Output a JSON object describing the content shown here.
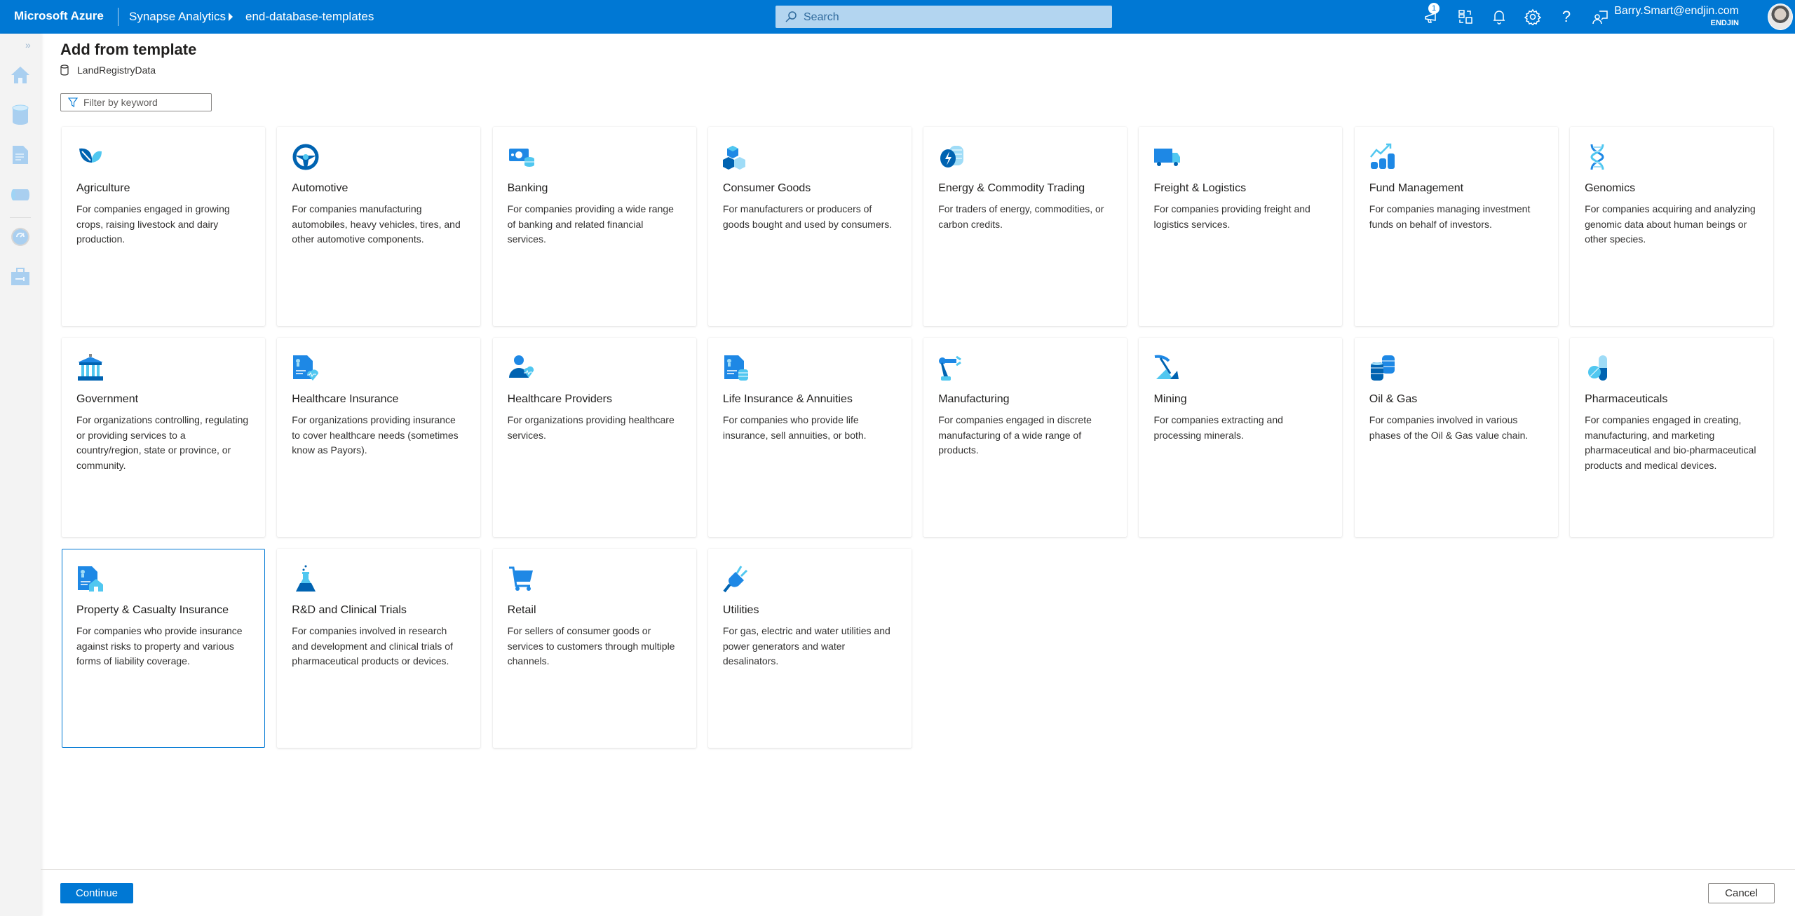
{
  "header": {
    "brand": "Microsoft Azure",
    "breadcrumb": [
      "Synapse Analytics",
      "end-database-templates"
    ],
    "search_placeholder": "Search",
    "notification_count": "1",
    "user_email": "Barry.Smart@endjin.com",
    "user_org": "ENDJIN",
    "icons": [
      "announcement-icon",
      "directory-switch-icon",
      "bell-icon",
      "gear-icon",
      "help-icon",
      "feedback-icon"
    ]
  },
  "sidebar": {
    "expand_label": "»",
    "items": [
      "home-icon",
      "data-icon",
      "develop-icon",
      "integrate-icon",
      "monitor-icon",
      "manage-icon"
    ]
  },
  "page": {
    "title": "Add from template",
    "database_name": "LandRegistryData",
    "filter_placeholder": "Filter by keyword"
  },
  "templates": [
    {
      "title": "Agriculture",
      "desc": "For companies engaged in growing crops, raising livestock and dairy production.",
      "icon": "leaf"
    },
    {
      "title": "Automotive",
      "desc": "For companies manufacturing automobiles, heavy vehicles, tires, and other automotive components.",
      "icon": "steering-wheel"
    },
    {
      "title": "Banking",
      "desc": "For companies providing a wide range of banking and related financial services.",
      "icon": "money"
    },
    {
      "title": "Consumer Goods",
      "desc": "For manufacturers or producers of goods bought and used by consumers.",
      "icon": "cubes"
    },
    {
      "title": "Energy & Commodity Trading",
      "desc": "For traders of energy, commodities, or carbon credits.",
      "icon": "energy"
    },
    {
      "title": "Freight & Logistics",
      "desc": "For companies providing freight and logistics services.",
      "icon": "truck"
    },
    {
      "title": "Fund Management",
      "desc": "For companies managing investment funds on behalf of investors.",
      "icon": "coins-chart"
    },
    {
      "title": "Genomics",
      "desc": "For companies acquiring and analyzing genomic data about human beings or other species.",
      "icon": "dna"
    },
    {
      "title": "Government",
      "desc": "For organizations controlling, regulating or providing services to a country/region, state or province, or community.",
      "icon": "building"
    },
    {
      "title": "Healthcare Insurance",
      "desc": "For organizations providing insurance to cover healthcare needs (sometimes know as Payors).",
      "icon": "doc-heart"
    },
    {
      "title": "Healthcare Providers",
      "desc": "For organizations providing healthcare services.",
      "icon": "person-heart"
    },
    {
      "title": "Life Insurance & Annuities",
      "desc": "For companies who provide life insurance, sell annuities, or both.",
      "icon": "doc-coins"
    },
    {
      "title": "Manufacturing",
      "desc": "For companies engaged in discrete manufacturing of a wide range of products.",
      "icon": "robot-arm"
    },
    {
      "title": "Mining",
      "desc": "For companies extracting and processing minerals.",
      "icon": "pickaxe"
    },
    {
      "title": "Oil & Gas",
      "desc": "For companies involved in various phases of the Oil & Gas value chain.",
      "icon": "barrels"
    },
    {
      "title": "Pharmaceuticals",
      "desc": "For companies engaged in creating, manufacturing, and marketing pharmaceutical and bio-pharmaceutical products and medical devices.",
      "icon": "pill"
    },
    {
      "title": "Property & Casualty Insurance",
      "desc": "For companies who provide insurance against risks to property and various forms of liability coverage.",
      "icon": "doc-house",
      "selected": true
    },
    {
      "title": "R&D and Clinical Trials",
      "desc": "For companies involved in research and development and clinical trials of pharmaceutical products or devices.",
      "icon": "flask"
    },
    {
      "title": "Retail",
      "desc": "For sellers of consumer goods or services to customers through multiple channels.",
      "icon": "cart"
    },
    {
      "title": "Utilities",
      "desc": "For gas, electric and water utilities and power generators and water desalinators.",
      "icon": "plug"
    }
  ],
  "footer": {
    "continue_label": "Continue",
    "cancel_label": "Cancel"
  },
  "colors": {
    "accent": "#0078d4",
    "icon_dark": "#0063b1",
    "icon_light": "#50c7f0"
  }
}
